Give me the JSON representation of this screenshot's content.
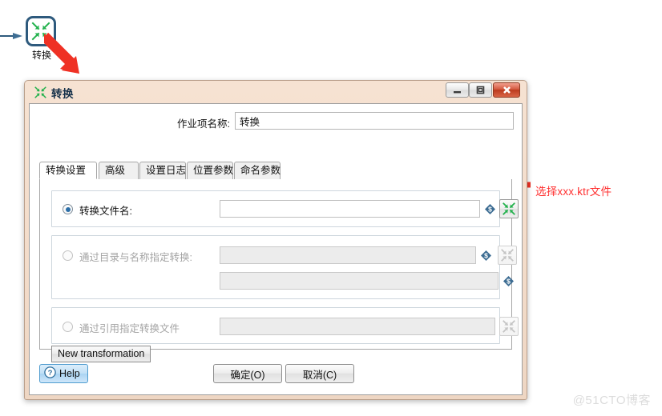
{
  "canvas": {
    "node_label": "转换",
    "node_icon": "transformation-icon",
    "hop_icon": "hop-arrow-icon"
  },
  "annotations": {
    "arrow_to_dialog": "red-arrow-down-right-icon",
    "arrow_to_browse": "red-arrow-left-icon",
    "browse_note": "选择xxx.ktr文件"
  },
  "dialog": {
    "title": "转换",
    "title_icon": "transformation-icon",
    "window_buttons": {
      "minimize": "minimize-icon",
      "maximize": "maximize-icon",
      "close": "close-icon"
    },
    "job_entry_name": {
      "label": "作业项名称:",
      "value": "转换",
      "placeholder": ""
    },
    "tabs": [
      {
        "label": "转换设置",
        "active": true
      },
      {
        "label": "高级",
        "active": false
      },
      {
        "label": "设置日志",
        "active": false
      },
      {
        "label": "位置参数",
        "active": false
      },
      {
        "label": "命名参数",
        "active": false
      }
    ],
    "options": [
      {
        "radio_label": "转换文件名:",
        "selected": true,
        "enabled": true,
        "field_value": "",
        "field_placeholder": "",
        "variable_icon": "dollar-variable-icon",
        "browse_icon": "transformation-browse-icon"
      },
      {
        "radio_label": "通过目录与名称指定转换:",
        "selected": false,
        "enabled": false,
        "field_value": "",
        "field_placeholder": "",
        "second_field_value": "",
        "variable_icon": "dollar-variable-icon",
        "browse_icon": "transformation-browse-icon"
      },
      {
        "radio_label": "通过引用指定转换文件",
        "selected": false,
        "enabled": false,
        "field_value": "",
        "field_placeholder": "",
        "browse_icon": "transformation-browse-icon"
      }
    ],
    "new_transformation_label": "New transformation",
    "help_label": "Help",
    "help_icon": "question-mark-icon",
    "ok_label": "确定(O)",
    "cancel_label": "取消(C)"
  },
  "watermark": "@51CTO博客",
  "colors": {
    "accent_green": "#22b14c",
    "node_border": "#2e5a7d",
    "annotation_red": "#ff2f2f",
    "title_bar": "#f3dcca",
    "close_button": "#bb3a1d",
    "help_blue": "#bfdff6",
    "watermark": "#dcdcdc"
  }
}
